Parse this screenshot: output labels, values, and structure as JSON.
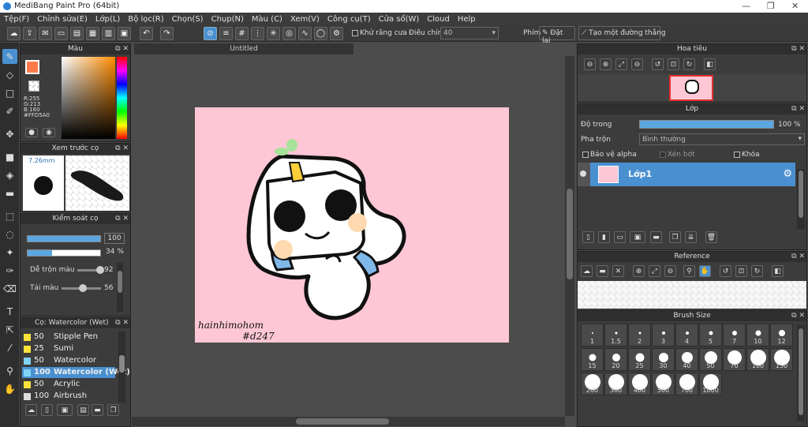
{
  "title": "MediBang Paint Pro (64bit)",
  "menu": [
    "Tệp(F)",
    "Chỉnh sửa(E)",
    "Lớp(L)",
    "Bộ lọc(R)",
    "Chọn(S)",
    "Chụp(N)",
    "Màu (C)",
    "Xem(V)",
    "Công cụ(T)",
    "Cửa sổ(W)",
    "Cloud",
    "Help"
  ],
  "toolbar": {
    "antialias_label": "Khử răng cưa",
    "adjust_label": "Điều chỉnh",
    "adjust_value": "40",
    "phim_label": "Phím",
    "reset_label": "Đặt lại",
    "line_label": "Tạo một đường thẳng"
  },
  "color_panel": {
    "title": "Màu",
    "current_color": "#FFD5A0",
    "r": "R:255",
    "g": "G:213",
    "b": "B:160",
    "hex": "#FFD5A0"
  },
  "preview_panel": {
    "title": "Xem trước cọ",
    "size": "7.26mm"
  },
  "brush_control": {
    "title": "Kiểm soát cọ",
    "opacity": 100,
    "opacity_text": "100",
    "size_pct": 34,
    "size_text": "34 %",
    "blend_label": "Dễ trộn màu",
    "blend_value": "92",
    "load_label": "Tải màu",
    "load_value": "56"
  },
  "brush_list": {
    "title": "Cọ: Watercolor (Wet)",
    "items": [
      {
        "n": "50",
        "name": "Stipple Pen",
        "color": "#ffe23a"
      },
      {
        "n": "25",
        "name": "Sumi",
        "color": "#ffe23a"
      },
      {
        "n": "50",
        "name": "Watercolor",
        "color": "#7fd3f5"
      },
      {
        "n": "100",
        "name": "Watercolor (Wet)",
        "color": "#7fd3f5"
      },
      {
        "n": "50",
        "name": "Acrylic",
        "color": "#ffe23a"
      },
      {
        "n": "100",
        "name": "Airbrush",
        "color": "#dddddd"
      }
    ]
  },
  "document": {
    "tab": "Untitled",
    "signature_line1": "hainhimohom",
    "signature_line2": "#d247"
  },
  "navigator": {
    "title": "Hoa tiêu"
  },
  "layers": {
    "title": "Lớp",
    "opacity_label": "Độ trong",
    "opacity": 100,
    "opacity_text": "100 %",
    "blend_label": "Pha trộn",
    "blend_value": "Bình thường",
    "protect_alpha": "Bảo vệ alpha",
    "clip": "Xén bớt",
    "lock": "Khóa",
    "layer_name": "Lớp1"
  },
  "reference": {
    "title": "Reference"
  },
  "brush_size": {
    "title": "Brush Size",
    "sizes": [
      "1",
      "1.5",
      "2",
      "3",
      "4",
      "5",
      "7",
      "10",
      "12",
      "15",
      "20",
      "25",
      "30",
      "40",
      "50",
      "70",
      "100",
      "150",
      "200",
      "300",
      "400",
      "500",
      "700",
      "1000"
    ]
  }
}
